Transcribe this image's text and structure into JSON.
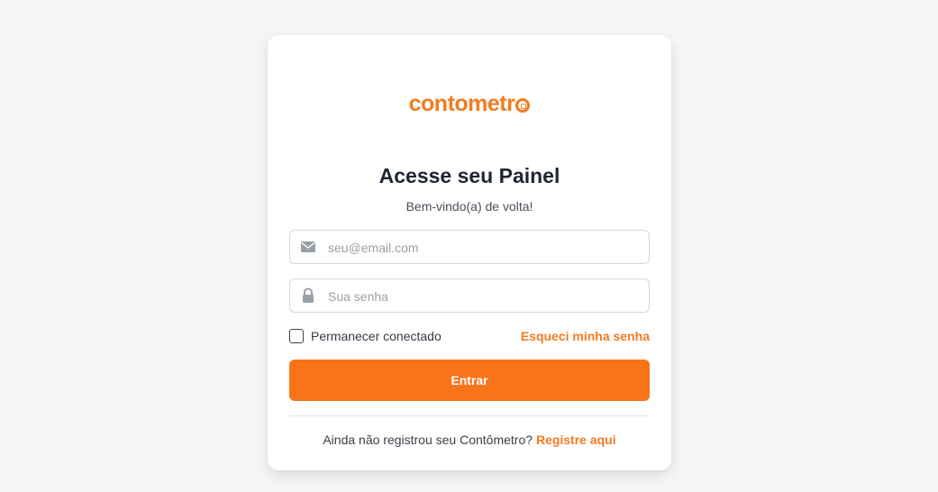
{
  "logo": {
    "text": "contometr",
    "icon": "camera-o-icon",
    "color": "#f47b20"
  },
  "heading": {
    "title": "Acesse seu Painel",
    "subtitle": "Bem-vindo(a) de volta!"
  },
  "email": {
    "icon": "envelope-icon",
    "placeholder": "seu@email.com",
    "value": ""
  },
  "password": {
    "icon": "lock-icon",
    "placeholder": "Sua senha",
    "value": ""
  },
  "remember": {
    "label": "Permanecer conectado",
    "checked": false
  },
  "forgot_link": "Esqueci minha senha",
  "submit_label": "Entrar",
  "footer": {
    "prompt": "Ainda não registrou seu Contômetro?",
    "link": "Registre aqui"
  },
  "colors": {
    "accent": "#f47b20",
    "button": "#f8741b",
    "background": "#f6f6f6",
    "title": "#1f2533"
  }
}
